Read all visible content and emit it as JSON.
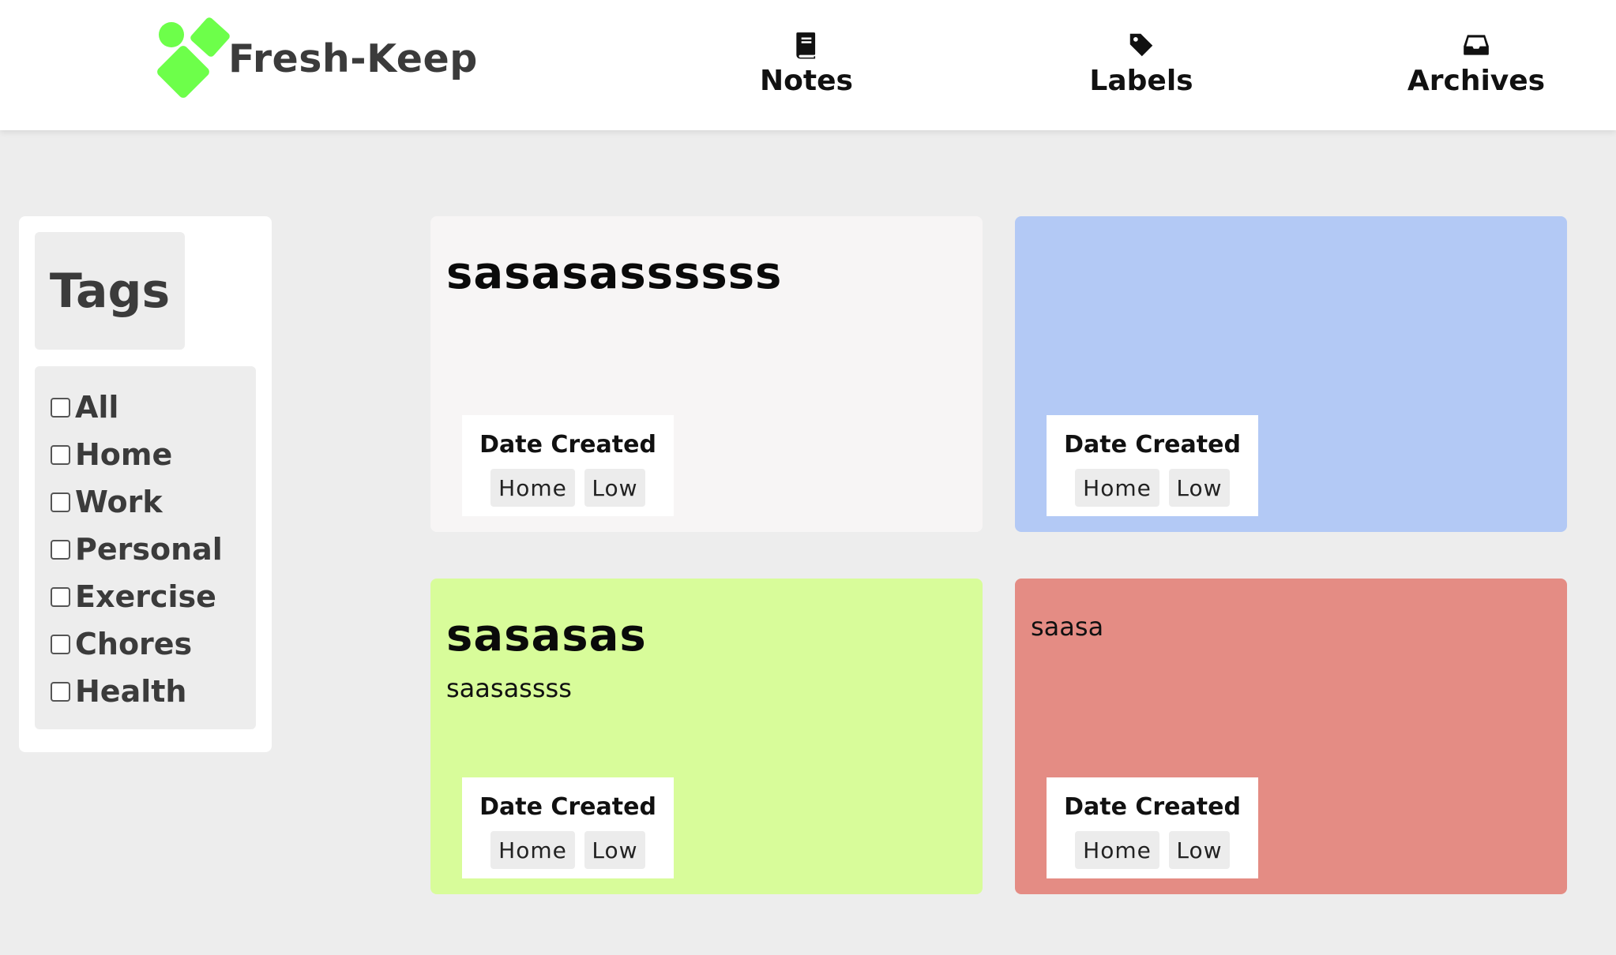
{
  "app": {
    "name": "Fresh-Keep",
    "logo_color": "#6dff4a"
  },
  "nav": {
    "items": [
      {
        "label": "Notes",
        "icon": "book-icon"
      },
      {
        "label": "Labels",
        "icon": "tag-icon"
      },
      {
        "label": "Archives",
        "icon": "inbox-icon"
      }
    ]
  },
  "sidebar": {
    "heading": "Tags",
    "tags": [
      "All",
      "Home",
      "Work",
      "Personal",
      "Exercise",
      "Chores",
      "Health"
    ]
  },
  "notes": [
    {
      "title": "sasasassssss",
      "body": "",
      "color": "#f7f5f5",
      "date_label": "Date Created",
      "category": "Home",
      "priority": "Low"
    },
    {
      "title": "",
      "body": "",
      "color": "#b3c9f5",
      "date_label": "Date Created",
      "category": "Home",
      "priority": "Low"
    },
    {
      "title": "sasasas",
      "body": "saasassss",
      "color": "#d8fc9a",
      "date_label": "Date Created",
      "category": "Home",
      "priority": "Low"
    },
    {
      "title": "",
      "body": "saasa",
      "color": "#e48c84",
      "date_label": "Date Created",
      "category": "Home",
      "priority": "Low"
    }
  ]
}
